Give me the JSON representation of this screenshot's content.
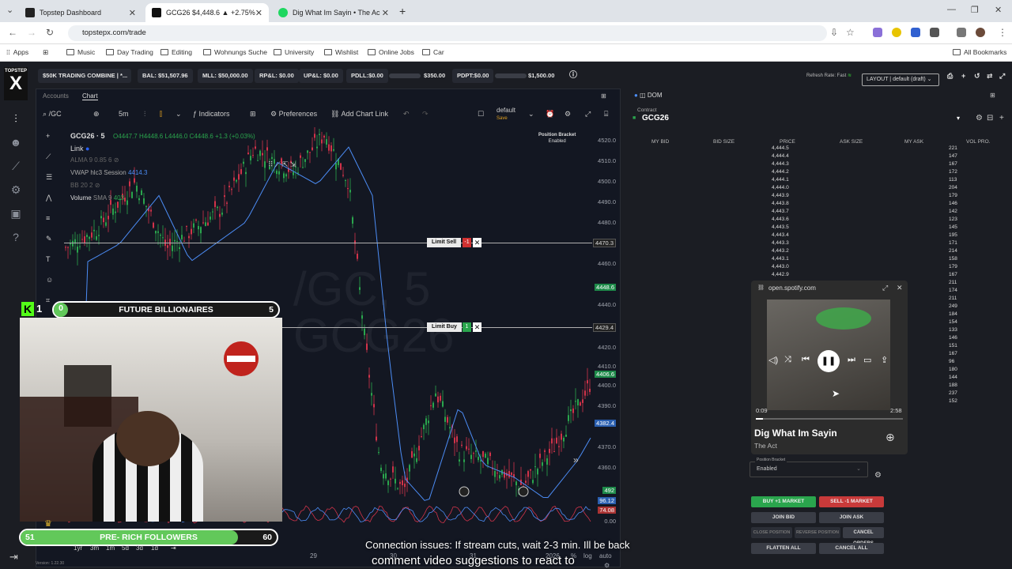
{
  "browser": {
    "tabs": [
      {
        "title": "Topstep Dashboard",
        "color": "#ffffff"
      },
      {
        "title": "GCG26 $4,448.6 ▲ +2.75%",
        "color": "#111111"
      },
      {
        "title": "Dig What Im Sayin • The Ac",
        "color": "#1ed760"
      }
    ],
    "url": "topstepx.com/trade",
    "bookmarks": [
      "Apps",
      "Music",
      "Day Trading",
      "Editing",
      "Wohnungs Suche",
      "University",
      "Wishlist",
      "Online Jobs",
      "Car"
    ],
    "all_bookmarks": "All Bookmarks"
  },
  "app": {
    "logo_top": "TOPSTEP",
    "logo_x": "X",
    "account": "$50K TRADING COMBINE | *...",
    "stats": {
      "bal": "BAL: $51,507.96",
      "mll": "MLL: $50,000.00",
      "rpl": "RP&L: $0.00",
      "upl": "UP&L: $0.00",
      "pdll": "PDLL:$0.00",
      "pdll_max": "$350.00",
      "pdpt": "PDPT:$0.00",
      "pdpt_max": "$1,500.00"
    },
    "refresh": "Refresh Rate: Fast",
    "layout": "LAYOUT | default (draft)"
  },
  "chart": {
    "tabs": [
      "Accounts",
      "Chart"
    ],
    "symbol": "/GC",
    "timeframe": "5m",
    "indicators_label": "Indicators",
    "preferences_label": "Preferences",
    "add_chart_link": "Add Chart Link",
    "template": "default",
    "template_sub": "Save",
    "position_bracket": "Position Bracket",
    "position_bracket_state": "Enabled",
    "legend": {
      "title": "GCG26 · 5",
      "ohlc": "O4447.7 H4448.6 L4446.0 C4448.6 +1.3 (+0.03%)",
      "link": "Link",
      "alma": "ALMA 9 0.85 6",
      "vwap": "VWAP hlc3 Session",
      "vwap_val": "4414.3",
      "bb": "BB 20 2",
      "volume": "Volume",
      "sma": "SMA 9",
      "sma_val": "403"
    },
    "limit_sell": "Limit Sell",
    "limit_sell_qty": "-1",
    "limit_buy": "Limit Buy",
    "limit_buy_qty": "1",
    "y_labels": [
      "4520.0",
      "4510.0",
      "4500.0",
      "4490.0",
      "4480.0",
      "4460.0",
      "4440.0",
      "4420.0",
      "4410.0",
      "4400.0",
      "4390.0",
      "4370.0",
      "4360.0"
    ],
    "y_tags": {
      "limit_sell": "4470.3",
      "last": "4448.6",
      "limit_buy": "4429.4",
      "tag1": "4406.6",
      "vwap": "4382.4",
      "vol": "492",
      "osc1": "96.12",
      "osc2": "74.08",
      "zero": "0.00"
    },
    "x_labels": [
      "29",
      "30",
      "31",
      "2026"
    ],
    "watermark": "/GC, 5",
    "watermark2": "GCG26",
    "range_buttons": [
      "1yr",
      "3m",
      "1m",
      "5d",
      "3d",
      "1d"
    ],
    "pct_label": "%",
    "log_label": "log",
    "auto_label": "auto",
    "version": "Version: 1.22.30",
    "chart_data": {
      "type": "line",
      "title": "GCG26 · 5",
      "x": [
        "29",
        "30",
        "31",
        "2026"
      ],
      "ylim": [
        4360,
        4525
      ],
      "series": [
        {
          "name": "",
          "values": [
            4480,
            4470,
            4410,
            4436
          ]
        }
      ]
    }
  },
  "dom": {
    "title": "DOM",
    "contract_label": "Contract",
    "contract": "GCG26",
    "columns": [
      "MY BID",
      "BID SIZE",
      "PRICE",
      "ASK SIZE",
      "MY ASK",
      "VOL PRO."
    ],
    "prices": [
      "4,444.5",
      "4,444.4",
      "4,444.3",
      "4,444.2",
      "4,444.1",
      "4,444.0",
      "4,443.9",
      "4,443.8",
      "4,443.7",
      "4,443.6",
      "4,443.5",
      "4,443.4",
      "4,443.3",
      "4,443.2",
      "4,443.1",
      "4,443.0",
      "4,442.9"
    ],
    "vol_pro": [
      "221",
      "147",
      "167",
      "172",
      "113",
      "204",
      "179",
      "146",
      "142",
      "123",
      "145",
      "195",
      "171",
      "214",
      "158",
      "179",
      "167",
      "211",
      "174",
      "211",
      "249",
      "184",
      "154",
      "133",
      "146",
      "151",
      "167",
      "96",
      "180",
      "144",
      "188",
      "237",
      "152"
    ],
    "position_bracket_label": "Position Bracket",
    "position_bracket_value": "Enabled",
    "buttons": {
      "buy_market": "BUY +1 MARKET",
      "sell_market": "SELL -1 MARKET",
      "join_bid": "JOIN BID",
      "join_ask": "JOIN ASK",
      "close_position": "CLOSE POSITION",
      "reverse_position": "REVERSE POSITION",
      "cancel_orders": "CANCEL ORDERS",
      "flatten_all": "FLATTEN ALL",
      "cancel_all": "CANCEL ALL"
    }
  },
  "spotify": {
    "host": "open.spotify.com",
    "elapsed": "0:09",
    "duration": "2:58",
    "progress": 0.05,
    "track": "Dig What Im Sayin",
    "artist": "The Act"
  },
  "overlay": {
    "goal_top_label": "FUTURE BILLIONAIRES",
    "goal_top_current": "0",
    "goal_top_target": "5",
    "goal_top_progress": 0.0,
    "kick_count": "1",
    "goal_bottom_label": "PRE- RICH FOLLOWERS",
    "goal_bottom_current": "51",
    "goal_bottom_target": "60",
    "goal_bottom_progress": 0.85
  },
  "captions": {
    "line1": "Connection issues: If stream cuts, wait 2-3 min. Ill be back",
    "line2": "comment video suggestions to react to"
  }
}
